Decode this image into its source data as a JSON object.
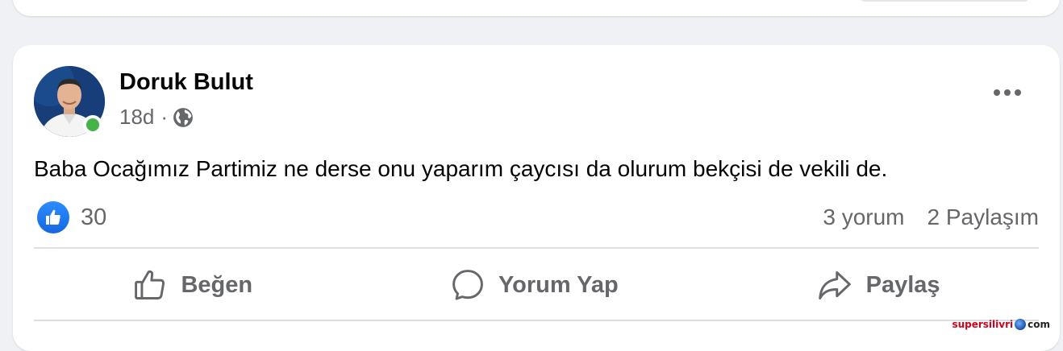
{
  "post": {
    "author": "Doruk Bulut",
    "time": "18d",
    "separator": "·",
    "text": "Baba Ocağımız Partimiz ne derse onu yaparım çaycısı da olurum bekçisi de vekili de.",
    "like_count": "30",
    "comment_count": "3 yorum",
    "share_count": "2 Paylaşım"
  },
  "actions": {
    "like": "Beğen",
    "comment": "Yorum Yap",
    "share": "Paylaş"
  },
  "watermark": {
    "brand": "supersilivri",
    "suffix": "com"
  },
  "colors": {
    "background": "#eff1f4",
    "secondary_text": "#65676b",
    "like_blue": "#1877f2",
    "online_green": "#44b449"
  },
  "icons": [
    "globe-icon",
    "more-options-icon",
    "like-reaction-icon",
    "thumbs-up-icon",
    "comment-icon",
    "share-arrow-icon"
  ]
}
